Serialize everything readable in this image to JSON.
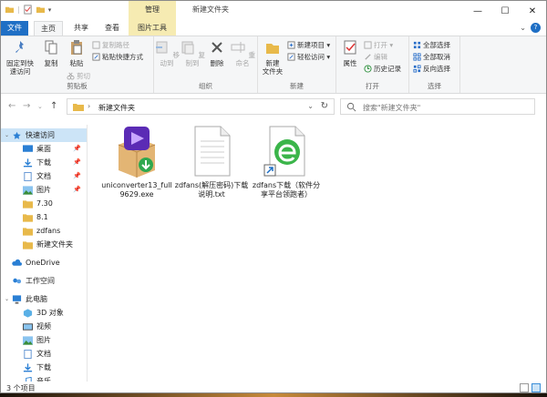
{
  "window": {
    "title": "新建文件夹",
    "minimize": "—",
    "maximize": "☐",
    "close": "✕"
  },
  "tabs": {
    "context_label": "管理",
    "file": "文件",
    "home": "主页",
    "share": "共享",
    "view": "查看",
    "picture_tools": "图片工具"
  },
  "ribbon": {
    "clipboard": {
      "label": "剪贴板",
      "pin": "固定到快\n速访问",
      "copy": "复制",
      "paste": "粘贴",
      "copy_path": "复制路径",
      "paste_shortcut": "粘贴快捷方式",
      "cut": "剪切"
    },
    "organize": {
      "label": "组织",
      "move_to": "移动到",
      "copy_to": "复制到",
      "delete": "删除",
      "rename": "重命名"
    },
    "new": {
      "label": "新建",
      "new_folder": "新建\n文件夹",
      "new_item": "新建项目 ▾",
      "easy_access": "轻松访问 ▾"
    },
    "open": {
      "label": "打开",
      "properties": "属性",
      "open": "打开 ▾",
      "edit": "编辑",
      "history": "历史记录"
    },
    "select": {
      "label": "选择",
      "select_all": "全部选择",
      "select_none": "全部取消",
      "invert": "反向选择"
    }
  },
  "address": {
    "path": "新建文件夹",
    "separator": "›"
  },
  "search": {
    "placeholder": "搜索\"新建文件夹\""
  },
  "nav": {
    "quick_access": "快速访问",
    "desktop": "桌面",
    "downloads": "下载",
    "documents": "文档",
    "pictures": "图片",
    "f730": "7.30",
    "f81": "8.1",
    "zdfans": "zdfans",
    "newfolder": "新建文件夹",
    "onedrive": "OneDrive",
    "workspace": "工作空间",
    "thispc": "此电脑",
    "objects3d": "3D 对象",
    "videos": "视频",
    "pictures2": "图片",
    "documents2": "文档",
    "downloads2": "下载",
    "music": "音乐"
  },
  "files": [
    {
      "name": "uniconverter13_full9629.exe"
    },
    {
      "name": "zdfans(解压密码)下载说明.txt"
    },
    {
      "name": "zdfans下载（软件分享平台领跑者）"
    }
  ],
  "status": {
    "count": "3 个项目"
  }
}
